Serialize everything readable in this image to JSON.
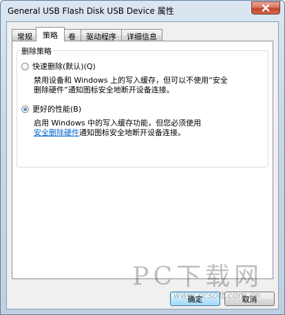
{
  "window": {
    "title": "General USB Flash Disk USB Device 属性"
  },
  "tabs": [
    {
      "label": "常规"
    },
    {
      "label": "策略",
      "active": true
    },
    {
      "label": "卷"
    },
    {
      "label": "驱动程序"
    },
    {
      "label": "详细信息"
    }
  ],
  "policy": {
    "group_label": "删除策略",
    "options": [
      {
        "label": "快速删除(默认)(Q)",
        "checked": false,
        "description_1": "禁用设备和 Windows 上的写入缓存，但可以不使用“安全",
        "description_2": "删除硬件”通知图标安全地断开设备连接。"
      },
      {
        "label": "更好的性能(B)",
        "checked": true,
        "description_1": "启用 Windows 中的写入缓存功能，但您必须使用",
        "link": "安全删除硬件",
        "description_2": "通知图标安全地断开设备连接。"
      }
    ]
  },
  "buttons": {
    "ok": "确定",
    "cancel": "取消"
  },
  "watermark": {
    "main": "PC下载网",
    "sub": "www.pcsoft.com.cn"
  },
  "colors": {
    "link": "#0066cc",
    "close_button": "#c2452f",
    "radio_dot": "#3072b8"
  }
}
